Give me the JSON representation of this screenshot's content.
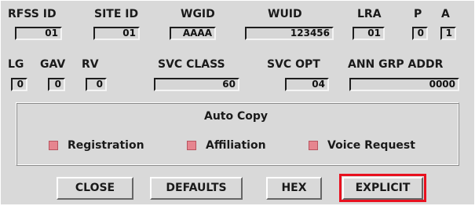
{
  "row1": {
    "labels": {
      "rfss_id": "RFSS ID",
      "site_id": "SITE ID",
      "wgid": "WGID",
      "wuid": "WUID",
      "lra": "LRA",
      "p": "P",
      "a": "A"
    },
    "values": {
      "rfss_id": "01",
      "site_id": "01",
      "wgid": "AAAA",
      "wuid": "123456",
      "lra": "01",
      "p": "0",
      "a": "1"
    }
  },
  "row2": {
    "labels": {
      "lg": "LG",
      "gav": "GAV",
      "rv": "RV",
      "svc_class": "SVC CLASS",
      "svc_opt": "SVC OPT",
      "ann_grp_addr": "ANN GRP ADDR"
    },
    "values": {
      "lg": "0",
      "gav": "0",
      "rv": "0",
      "svc_class": "60",
      "svc_opt": "04",
      "ann_grp_addr": "0000"
    }
  },
  "auto_copy": {
    "title": "Auto Copy",
    "registration": "Registration",
    "affiliation": "Affiliation",
    "voice_request": "Voice Request",
    "checkbox_color": "#e6858f"
  },
  "buttons": {
    "close": "CLOSE",
    "defaults": "DEFAULTS",
    "hex": "HEX",
    "explicit": "EXPLICIT"
  },
  "highlight_color": "#e8111f"
}
